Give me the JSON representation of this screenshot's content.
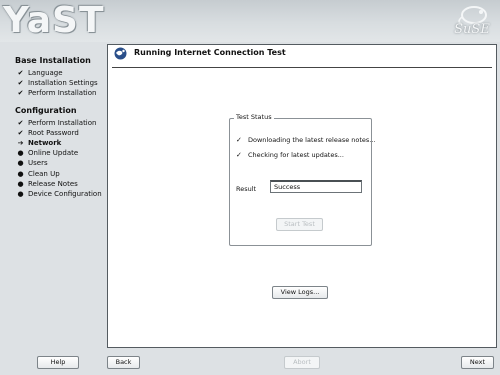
{
  "app": {
    "title": "YaST",
    "vendor": "SuSE"
  },
  "sidebar": {
    "sections": [
      {
        "title": "Base Installation",
        "steps": [
          {
            "label": "Language",
            "state": "done"
          },
          {
            "label": "Installation Settings",
            "state": "done"
          },
          {
            "label": "Perform Installation",
            "state": "done"
          }
        ]
      },
      {
        "title": "Configuration",
        "steps": [
          {
            "label": "Perform Installation",
            "state": "done"
          },
          {
            "label": "Root Password",
            "state": "done"
          },
          {
            "label": "Network",
            "state": "current"
          },
          {
            "label": "Online Update",
            "state": "pending"
          },
          {
            "label": "Users",
            "state": "pending"
          },
          {
            "label": "Clean Up",
            "state": "pending"
          },
          {
            "label": "Release Notes",
            "state": "pending"
          },
          {
            "label": "Device Configuration",
            "state": "pending"
          }
        ]
      }
    ]
  },
  "panel": {
    "title": "Running Internet Connection Test",
    "icon": "globe-icon",
    "test_status": {
      "title": "Test Status",
      "items": [
        {
          "label": "Downloading the latest release notes...",
          "done": true
        },
        {
          "label": "Checking for latest updates...",
          "done": true
        }
      ],
      "result_label": "Result",
      "result_value": "Success",
      "start_test_label": "Start Test"
    },
    "view_logs_label": "View Logs..."
  },
  "footer": {
    "help_label": "Help",
    "back_label": "Back",
    "abort_label": "Abort",
    "next_label": "Next"
  },
  "colors": {
    "panel_bg": "#ffffff",
    "window_bg": "#dde1e4",
    "border": "#545b60"
  }
}
